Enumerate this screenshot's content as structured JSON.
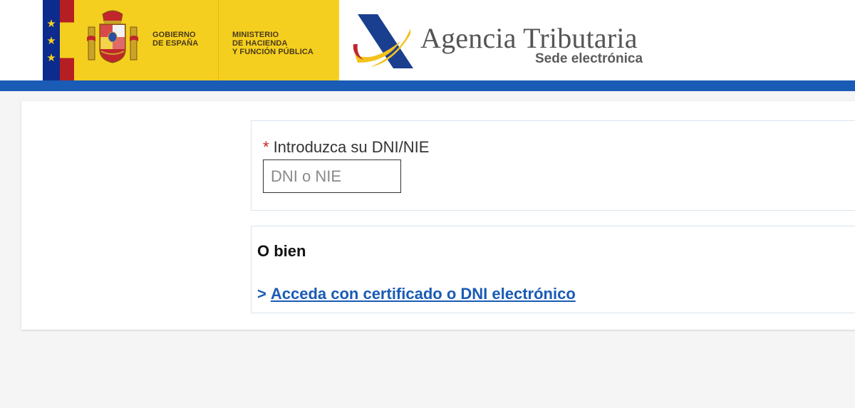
{
  "header": {
    "gov_name_lines": [
      "GOBIERNO",
      "DE ESPAÑA"
    ],
    "ministry_lines": [
      "MINISTERIO",
      "DE HACIENDA",
      "Y FUNCIÓN PÚBLICA"
    ],
    "agency_title": "Agencia Tributaria",
    "agency_subtitle": "Sede electrónica"
  },
  "form": {
    "required_mark": "*",
    "dni_label": "Introduzca su DNI/NIE",
    "dni_placeholder": "DNI o NIE",
    "dni_value": ""
  },
  "alternative": {
    "title": "O bien",
    "link_prefix": ">",
    "link_label": "Acceda con certificado o DNI electrónico"
  },
  "colors": {
    "brand_blue": "#1a5bb5",
    "gov_yellow": "#f5cf1f",
    "eu_blue": "#0c2b8c",
    "required_red": "#cc2020"
  }
}
